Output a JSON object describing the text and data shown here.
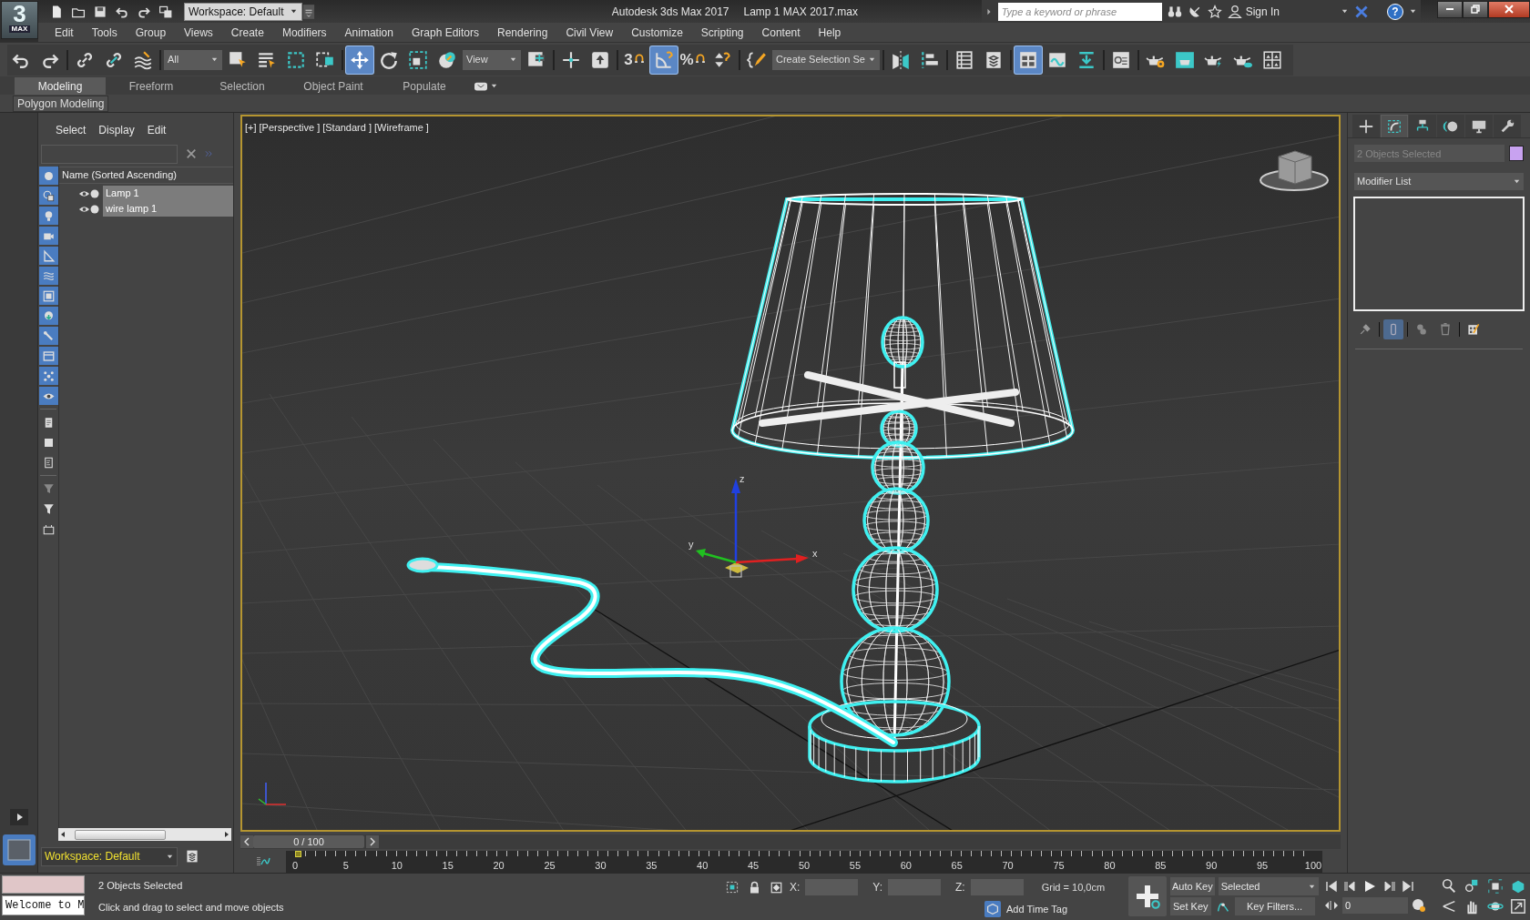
{
  "title_bar": {
    "logo": {
      "numeral": "3",
      "caption": "MAX"
    },
    "quick_access": [
      {
        "kind": "new"
      },
      {
        "kind": "open"
      },
      {
        "kind": "save"
      },
      {
        "kind": "undo"
      },
      {
        "kind": "redo"
      },
      {
        "kind": "project"
      }
    ],
    "workspace": "Workspace: Default",
    "app_title": "Autodesk 3ds Max 2017",
    "file_name": "Lamp 1 MAX 2017.max",
    "search_placeholder": "Type a keyword or phrase",
    "sign_in": "Sign In",
    "help": "?"
  },
  "menu_bar": [
    "Edit",
    "Tools",
    "Group",
    "Views",
    "Create",
    "Modifiers",
    "Animation",
    "Graph Editors",
    "Rendering",
    "Civil View",
    "Customize",
    "Scripting",
    "Content",
    "Help"
  ],
  "main_toolbar": {
    "groups": [
      [
        {
          "kind": "undo",
          "selected": false
        },
        {
          "kind": "redo",
          "selected": false
        }
      ],
      [
        {
          "kind": "link",
          "selected": false
        },
        {
          "kind": "unlink",
          "selected": false
        },
        {
          "kind": "bind_warp",
          "selected": false
        }
      ],
      [
        {
          "kind": "dropdown",
          "value": "All"
        },
        {
          "kind": "select_object",
          "selected": false
        },
        {
          "kind": "select_by_name",
          "selected": false
        },
        {
          "kind": "rect_region",
          "selected": false
        },
        {
          "kind": "window_crossing",
          "selected": false
        }
      ],
      [
        {
          "kind": "move",
          "selected": true
        },
        {
          "kind": "rotate",
          "selected": false
        },
        {
          "kind": "scale",
          "selected": false
        },
        {
          "kind": "place",
          "selected": false
        },
        {
          "kind": "dropdown",
          "value": "View"
        },
        {
          "kind": "pivot",
          "selected": false
        }
      ],
      [
        {
          "kind": "manipulate",
          "selected": false
        },
        {
          "kind": "keyboard_override",
          "selected": false
        }
      ],
      [
        {
          "kind": "snap",
          "label": "3",
          "selected": false
        },
        {
          "kind": "angle_snap",
          "selected": true
        },
        {
          "kind": "percent_snap",
          "label": "%",
          "selected": false
        },
        {
          "kind": "spinner_snap",
          "selected": false
        }
      ],
      [
        {
          "kind": "edit_named",
          "selected": false
        },
        {
          "kind": "dropdown",
          "value": "Create Selection Se"
        }
      ],
      [
        {
          "kind": "mirror",
          "selected": false
        },
        {
          "kind": "align",
          "selected": false
        }
      ],
      [
        {
          "kind": "scene_explorer",
          "selected": false
        },
        {
          "kind": "layer_explorer",
          "selected": false
        }
      ],
      [
        {
          "kind": "ribbon",
          "selected": true
        },
        {
          "kind": "curve_editor",
          "selected": false
        },
        {
          "kind": "schematic",
          "selected": false
        }
      ],
      [
        {
          "kind": "material_editor",
          "selected": false
        }
      ],
      [
        {
          "kind": "render_setup",
          "selected": false
        },
        {
          "kind": "render_frame",
          "selected": false
        },
        {
          "kind": "render",
          "selected": false
        },
        {
          "kind": "render_cloud",
          "selected": false
        },
        {
          "kind": "asset_grid",
          "selected": false
        }
      ]
    ]
  },
  "ribbon": {
    "tabs": [
      {
        "label": "Modeling",
        "selected": true
      },
      {
        "label": "Freeform",
        "selected": false
      },
      {
        "label": "Selection",
        "selected": false
      },
      {
        "label": "Object Paint",
        "selected": false
      },
      {
        "label": "Populate",
        "selected": false
      }
    ],
    "panel": "Polygon Modeling"
  },
  "scene_explorer": {
    "menu": [
      "Select",
      "Display",
      "Edit"
    ],
    "filters": [
      {
        "kind": "geometry",
        "selected": true
      },
      {
        "kind": "shapes",
        "selected": true
      },
      {
        "kind": "lights",
        "selected": true
      },
      {
        "kind": "cameras",
        "selected": true
      },
      {
        "kind": "helpers",
        "selected": true
      },
      {
        "kind": "space_warps",
        "selected": true
      },
      {
        "kind": "groups",
        "selected": true
      },
      {
        "kind": "xrefs",
        "selected": true
      },
      {
        "kind": "bones",
        "selected": true
      },
      {
        "kind": "containers",
        "selected": true
      },
      {
        "kind": "particles",
        "selected": true
      },
      {
        "kind": "hidden",
        "selected": true
      },
      {
        "kind": "display_children",
        "selected": false
      },
      {
        "kind": "display_influences",
        "selected": false
      },
      {
        "kind": "display_dependents",
        "selected": false
      },
      {
        "kind": "filter_options",
        "selected": false
      },
      {
        "kind": "filter",
        "selected": false
      },
      {
        "kind": "container_tool",
        "selected": false
      }
    ],
    "column": "Name (Sorted Ascending)",
    "rows": [
      {
        "name": "Lamp 1",
        "visible": true,
        "selected": true
      },
      {
        "name": "wire lamp 1",
        "visible": true,
        "selected": true
      }
    ],
    "workspace": "Workspace: Default"
  },
  "viewport": {
    "labels": [
      "[+]",
      "[Perspective ]",
      "[Standard ]",
      "[Wireframe ]"
    ],
    "active": true,
    "gizmo_axes": [
      "x",
      "y",
      "z"
    ]
  },
  "time_slider": {
    "position": "0 / 100",
    "level": 0,
    "ticks": [
      "0",
      "5",
      "10",
      "15",
      "20",
      "25",
      "30",
      "35",
      "40",
      "45",
      "50",
      "55",
      "60",
      "65",
      "70",
      "75",
      "80",
      "85",
      "90",
      "95",
      "100"
    ]
  },
  "command_panel": {
    "tabs": [
      {
        "kind": "create",
        "selected": false
      },
      {
        "kind": "modify",
        "selected": true
      },
      {
        "kind": "hierarchy",
        "selected": false
      },
      {
        "kind": "motion",
        "selected": false
      },
      {
        "kind": "display",
        "selected": false
      },
      {
        "kind": "utilities",
        "selected": false
      }
    ],
    "object": {
      "name": "2 Objects Selected",
      "disabled": true,
      "color": "#c8a2f0"
    },
    "modifier_list": "Modifier List",
    "stack_tools": [
      {
        "kind": "pin",
        "selected": false
      },
      {
        "kind": "end_result",
        "selected": true
      },
      {
        "kind": "make_unique",
        "selected": false
      },
      {
        "kind": "remove",
        "selected": false
      },
      {
        "kind": "configure",
        "selected": false
      }
    ]
  },
  "status_bar": {
    "listener": "Welcome to M",
    "selection": "2 Objects Selected",
    "prompt": "Click and drag to select and move objects",
    "coords": [
      "X:",
      "Y:",
      "Z:"
    ],
    "grid": "Grid = 10,0cm",
    "time_tag": "Add Time Tag",
    "auto_key": "Auto Key",
    "key_mode": "Selected",
    "set_key": "Set Key",
    "key_filters": "Key Filters...",
    "frame": "0"
  }
}
